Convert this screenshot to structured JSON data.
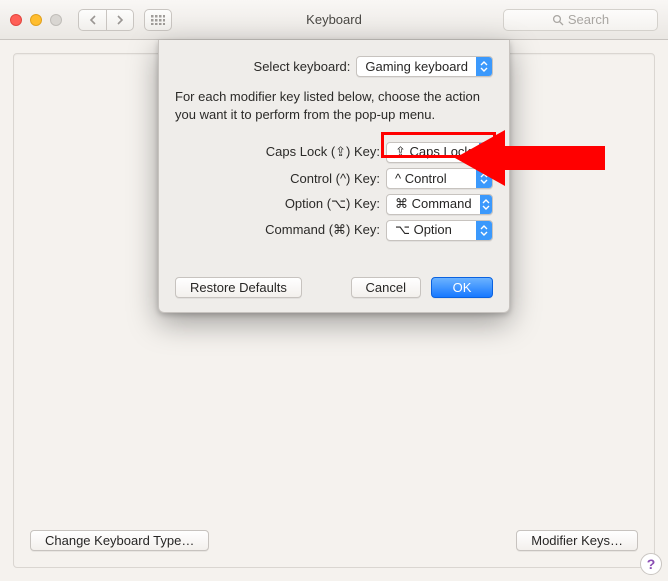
{
  "titlebar": {
    "title": "Keyboard"
  },
  "search": {
    "placeholder": "Search"
  },
  "sheet": {
    "select_label": "Select keyboard:",
    "keyboard_popup": "Gaming keyboard",
    "intro": "For each modifier key listed below, choose the action you want it to perform from the pop-up menu.",
    "rows": [
      {
        "label": "Caps Lock (⇪) Key:",
        "value": "⇪ Caps Lock",
        "highlighted": true
      },
      {
        "label": "Control (^) Key:",
        "value": "^ Control"
      },
      {
        "label": "Option (⌥) Key:",
        "value": "⌘ Command"
      },
      {
        "label": "Command (⌘) Key:",
        "value": "⌥ Option"
      }
    ],
    "restore_label": "Restore Defaults",
    "cancel_label": "Cancel",
    "ok_label": "OK"
  },
  "bottom": {
    "change_type": "Change Keyboard Type…",
    "modifier_keys": "Modifier Keys…"
  },
  "help_glyph": "?"
}
